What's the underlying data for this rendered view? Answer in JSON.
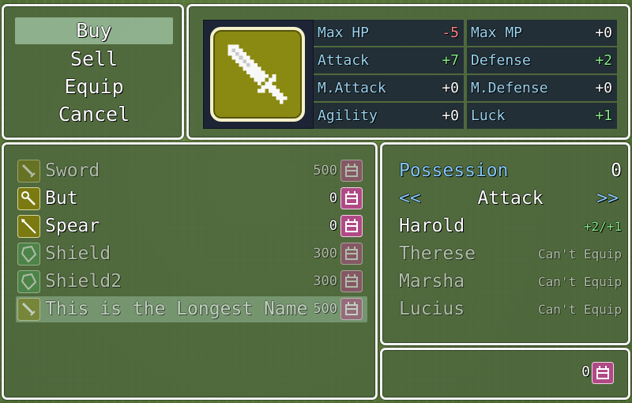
{
  "commands": [
    {
      "label": "Buy",
      "selected": true
    },
    {
      "label": "Sell",
      "selected": false
    },
    {
      "label": "Equip",
      "selected": false
    },
    {
      "label": "Cancel",
      "selected": false
    }
  ],
  "status": {
    "icon": "sword-icon",
    "stats": [
      {
        "label": "Max HP",
        "value": "-5",
        "tone": "neg"
      },
      {
        "label": "Max MP",
        "value": "+0",
        "tone": "zero"
      },
      {
        "label": "Attack",
        "value": "+7",
        "tone": "pos"
      },
      {
        "label": "Defense",
        "value": "+2",
        "tone": "pos"
      },
      {
        "label": "M.Attack",
        "value": "+0",
        "tone": "zero"
      },
      {
        "label": "M.Defense",
        "value": "+0",
        "tone": "zero"
      },
      {
        "label": "Agility",
        "value": "+0",
        "tone": "zero"
      },
      {
        "label": "Luck",
        "value": "+1",
        "tone": "pos"
      }
    ]
  },
  "items": [
    {
      "name": "Sword",
      "price": "500",
      "icon": "sword-icon",
      "enabled": false,
      "selected": false
    },
    {
      "name": "But",
      "price": "0",
      "icon": "staff-icon",
      "enabled": true,
      "selected": false
    },
    {
      "name": "Spear",
      "price": "0",
      "icon": "spear-icon",
      "enabled": true,
      "selected": false
    },
    {
      "name": "Shield",
      "price": "300",
      "icon": "shield-icon",
      "enabled": false,
      "selected": false
    },
    {
      "name": "Shield2",
      "price": "300",
      "icon": "shield-icon",
      "enabled": false,
      "selected": false
    },
    {
      "name": "This is the Longest Name",
      "price": "500",
      "icon": "sword-icon",
      "enabled": false,
      "selected": true
    }
  ],
  "compare": {
    "possession_label": "Possession",
    "possession_value": "0",
    "page_prev": "<<",
    "page_label": "Attack",
    "page_next": ">>",
    "actors": [
      {
        "name": "Harold",
        "result": "+2/+1",
        "can_equip": true
      },
      {
        "name": "Therese",
        "result": "Can't Equip",
        "can_equip": false
      },
      {
        "name": "Marsha",
        "result": "Can't Equip",
        "can_equip": false
      },
      {
        "name": "Lucius",
        "result": "Can't Equip",
        "can_equip": false
      }
    ]
  },
  "gold": {
    "value": "0",
    "icon": "coin-purse-icon"
  },
  "colors": {
    "stat_label": "#9ad3f0",
    "positive": "#84ee86",
    "negative": "#ff8585",
    "system_blue": "#84c7f4",
    "item_icon_bg": "#7a7a10",
    "shield_icon_bg": "#4e9a52",
    "coin_icon_bg": "#b04a86"
  }
}
